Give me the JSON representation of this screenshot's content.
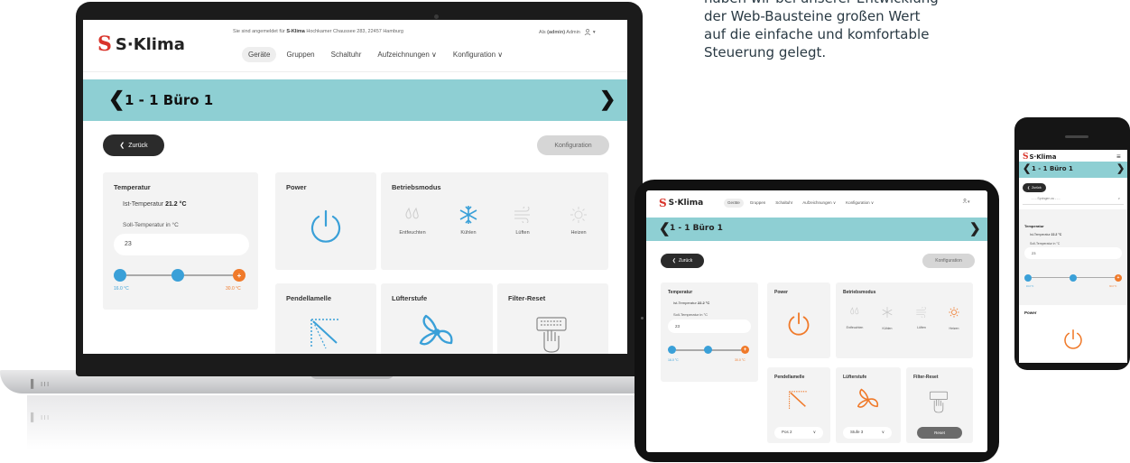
{
  "marketing": {
    "lines": [
      "haben wir bei unserer Entwicklung",
      "der Web-Bausteine großen Wert",
      "auf die einfache und komfortable",
      "Steuerung gelegt."
    ]
  },
  "brand": {
    "logo_mark": "S",
    "logo_text": "S·Klima",
    "accent": "#d9342b",
    "band_color": "#8ecfd3"
  },
  "header": {
    "info_prefix": "Sie sind angemeldet für ",
    "info_company": "S-Klima",
    "info_address": " Hochkamer Chaussee 283, 22457 Hamburg",
    "user_prefix": "Als ",
    "user_role": "(admin)",
    "user_name": " Admin",
    "user_icon": "user-icon"
  },
  "nav": {
    "items": [
      "Geräte",
      "Gruppen",
      "Schaltuhr",
      "Aufzeichnungen ∨",
      "Konfiguration ∨"
    ]
  },
  "device": {
    "prev": "❮",
    "title": "1 - 1 Büro 1",
    "next": "❯"
  },
  "actions": {
    "back": "Zurück",
    "back_icon": "❮",
    "config": "Konfiguration"
  },
  "temperature": {
    "title": "Temperatur",
    "ist_label": "Ist-Temperatur ",
    "ist_value": "21.2 °C",
    "tablet_ist_value": "22.2 °C",
    "phone_ist_value": "22.2 °C",
    "soll_label": "Soll-Temperatur in °C",
    "soll_value": "23",
    "min_label": "16.0 °C",
    "max_label": "30.0 °C",
    "plus": "+",
    "minus": "−"
  },
  "power": {
    "title": "Power",
    "icon": "power-icon",
    "state": "off",
    "color_laptop": "#3aa0d8",
    "color_tablet": "#f07a2a"
  },
  "mode": {
    "title": "Betriebsmodus",
    "items": [
      {
        "label": "Entfeuchten",
        "icon": "droplets-icon"
      },
      {
        "label": "Kühlen",
        "icon": "snowflake-icon"
      },
      {
        "label": "Lüften",
        "icon": "wind-icon"
      },
      {
        "label": "Heizen",
        "icon": "sun-icon"
      }
    ],
    "selected": "Kühlen"
  },
  "pendel": {
    "title": "Pendellamelle",
    "icon": "louver-icon",
    "value": "Pos 2",
    "arrow": "∨"
  },
  "fan": {
    "title": "Lüfterstufe",
    "icon": "fan-icon",
    "value": "Stufe 3",
    "arrow": "∨"
  },
  "filter": {
    "title": "Filter-Reset",
    "icon": "filter-hand-icon",
    "button": "Reset"
  },
  "phone": {
    "menu_icon": "≡",
    "jump_label": "- - - Springen zu - - -",
    "jump_arrow": "∨",
    "power_title": "Power"
  },
  "laptop": {
    "ports_1": "▌ ııı",
    "ports_2": "▌ ııı"
  }
}
